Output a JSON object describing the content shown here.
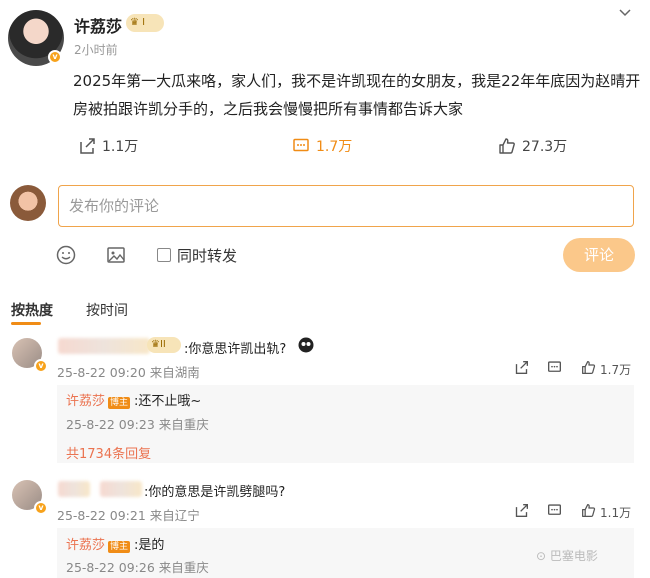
{
  "post": {
    "author": "许荔莎",
    "badge": "I",
    "time": "2小时前",
    "text": "2025年第一大瓜来咯，家人们，我不是许凯现在的女朋友，我是22年年底因为赵晴开房被拍跟许凯分手的，之后我会慢慢把所有事情都告诉大家",
    "actions": {
      "share": "1.1万",
      "comment": "1.7万",
      "like": "27.3万"
    }
  },
  "composer": {
    "placeholder": "发布你的评论",
    "repost_label": "同时转发",
    "submit_label": "评论"
  },
  "sort": {
    "hot": "按热度",
    "time": "按时间"
  },
  "comments": [
    {
      "badge": "II",
      "text": ":你意思许凯出轨?",
      "meta": "25-8-22 09:20 来自湖南",
      "likes": "1.7万",
      "reply": {
        "author": "许荔莎",
        "tag": "博主",
        "text": ":还不止哦~",
        "meta": "25-8-22 09:23 来自重庆"
      },
      "more_replies": "共1734条回复"
    },
    {
      "text": ":你的意思是许凯劈腿吗?",
      "meta": "25-8-22 09:21 来自辽宁",
      "likes": "1.1万",
      "reply": {
        "author": "许荔莎",
        "tag": "博主",
        "text": ":是的",
        "meta": "25-8-22 09:26 来自重庆"
      }
    }
  ],
  "watermark": "巴塞电影",
  "colors": {
    "accent": "#f08c16",
    "reply_name": "#eb7350",
    "submit_bg": "#fbc88a"
  },
  "icons": [
    "share-icon",
    "comment-icon",
    "like-icon",
    "emoji-icon",
    "image-icon",
    "chevron-down-icon",
    "verified-icon",
    "crown-icon"
  ]
}
